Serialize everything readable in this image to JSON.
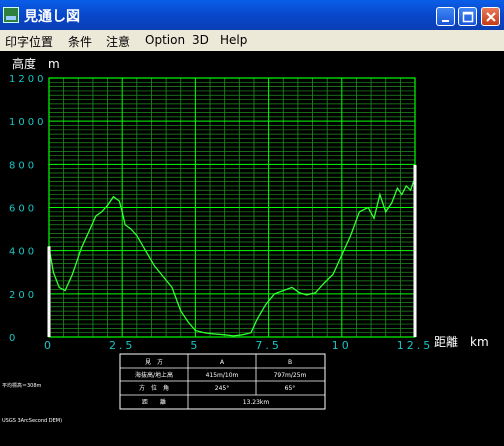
{
  "window": {
    "title": "見通し図"
  },
  "menu": [
    "印字位置",
    "条件",
    "注意",
    "Option",
    "3D",
    "Help"
  ],
  "chart_data": {
    "type": "line",
    "ylabel": "高度　m",
    "xlabel": "距離　km",
    "xlim": [
      0,
      12.5
    ],
    "ylim": [
      0,
      1200
    ],
    "x_ticks": [
      "0",
      "2.5",
      "5",
      "7.5",
      "10",
      "12.5"
    ],
    "y_ticks": [
      "0",
      "200",
      "400",
      "600",
      "800",
      "1000",
      "1200"
    ],
    "grid": true,
    "series": [
      {
        "x": [
          0,
          0.15,
          0.35,
          0.55,
          0.8,
          1.1,
          1.4,
          1.6,
          1.8,
          2.0,
          2.2,
          2.4,
          2.5,
          2.6,
          2.8,
          3.0,
          3.3,
          3.6,
          3.9,
          4.2,
          4.5,
          4.75,
          5.0,
          5.3,
          5.6,
          6.0,
          6.3,
          6.6,
          6.9,
          7.1,
          7.4,
          7.7,
          8.0,
          8.3,
          8.55,
          8.8,
          9.1,
          9.4,
          9.7,
          10.0,
          10.3,
          10.6,
          10.9,
          11.1,
          11.3,
          11.5,
          11.7,
          11.9,
          12.05,
          12.2,
          12.35,
          12.45,
          12.5
        ],
        "values": [
          415,
          300,
          230,
          215,
          290,
          410,
          500,
          560,
          580,
          610,
          650,
          630,
          580,
          520,
          500,
          470,
          400,
          330,
          280,
          230,
          120,
          70,
          30,
          20,
          15,
          10,
          5,
          10,
          20,
          80,
          150,
          200,
          215,
          230,
          205,
          195,
          205,
          250,
          290,
          380,
          470,
          580,
          600,
          550,
          660,
          580,
          620,
          690,
          660,
          700,
          680,
          720,
          730
        ]
      }
    ],
    "markers": [
      {
        "x": 0,
        "height": 420
      },
      {
        "x": 12.5,
        "height": 797
      }
    ]
  },
  "table": {
    "headers": [
      "見　方",
      "A",
      "B"
    ],
    "rows": [
      [
        "海抜高/地上高",
        "415m/10m",
        "797m/25m"
      ],
      [
        "方　位　角",
        "245°",
        "65°"
      ],
      [
        "距　　離",
        "13.23km"
      ]
    ]
  },
  "footnote_left": "平均標高＝308m",
  "footnote_source": "USGS 3ArcSecond DEM)"
}
